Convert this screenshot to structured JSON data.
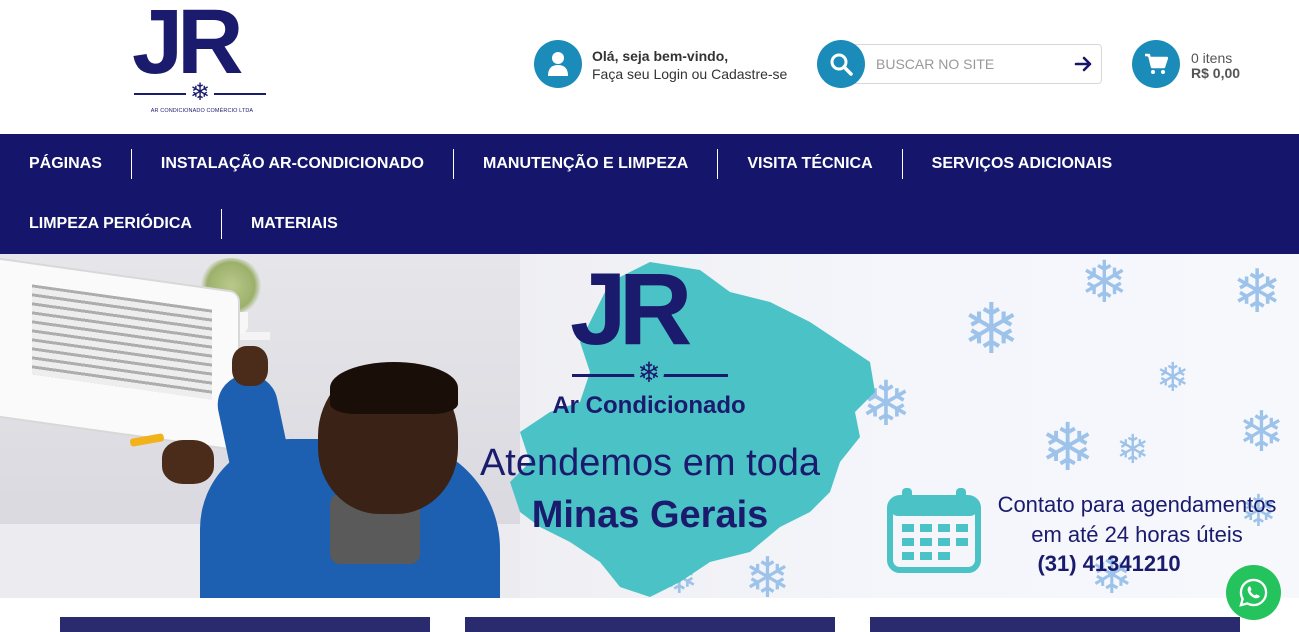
{
  "header": {
    "logo": {
      "text": "JR",
      "subtitle": "AR CONDICIONADO COMÉRCIO LTDA",
      "icon": "snowflake-icon"
    },
    "account": {
      "icon": "user-icon",
      "greeting": "Olá, seja bem-vindo,",
      "login_text": "Faça seu Login ou Cadastre-se"
    },
    "search": {
      "icon": "search-icon",
      "placeholder": "BUSCAR NO SITE",
      "submit_icon": "arrow-right-icon"
    },
    "cart": {
      "icon": "cart-icon",
      "items": "0 itens",
      "total": "R$ 0,00"
    }
  },
  "nav": {
    "row1": [
      "PÁGINAS",
      "INSTALAÇÃO AR-CONDICIONADO",
      "MANUTENÇÃO E LIMPEZA",
      "VISITA TÉCNICA",
      "SERVIÇOS ADICIONAIS"
    ],
    "row2": [
      "LIMPEZA PERIÓDICA",
      "MATERIAIS"
    ]
  },
  "banner": {
    "logo_text": "JR",
    "subtitle": "Ar Condicionado",
    "line1": "Atendemos em toda",
    "line2": "Minas Gerais",
    "contact_line1": "Contato para agendamentos",
    "contact_line2": "em até 24 horas úteis",
    "phone": "(31) 41341210",
    "calendar_icon": "calendar-icon"
  },
  "floating": {
    "whatsapp_icon": "whatsapp-icon"
  },
  "colors": {
    "navy": "#15166b",
    "accent_blue": "#1b8bba",
    "map_teal": "#4bc3c6",
    "whatsapp_green": "#25c35d"
  }
}
